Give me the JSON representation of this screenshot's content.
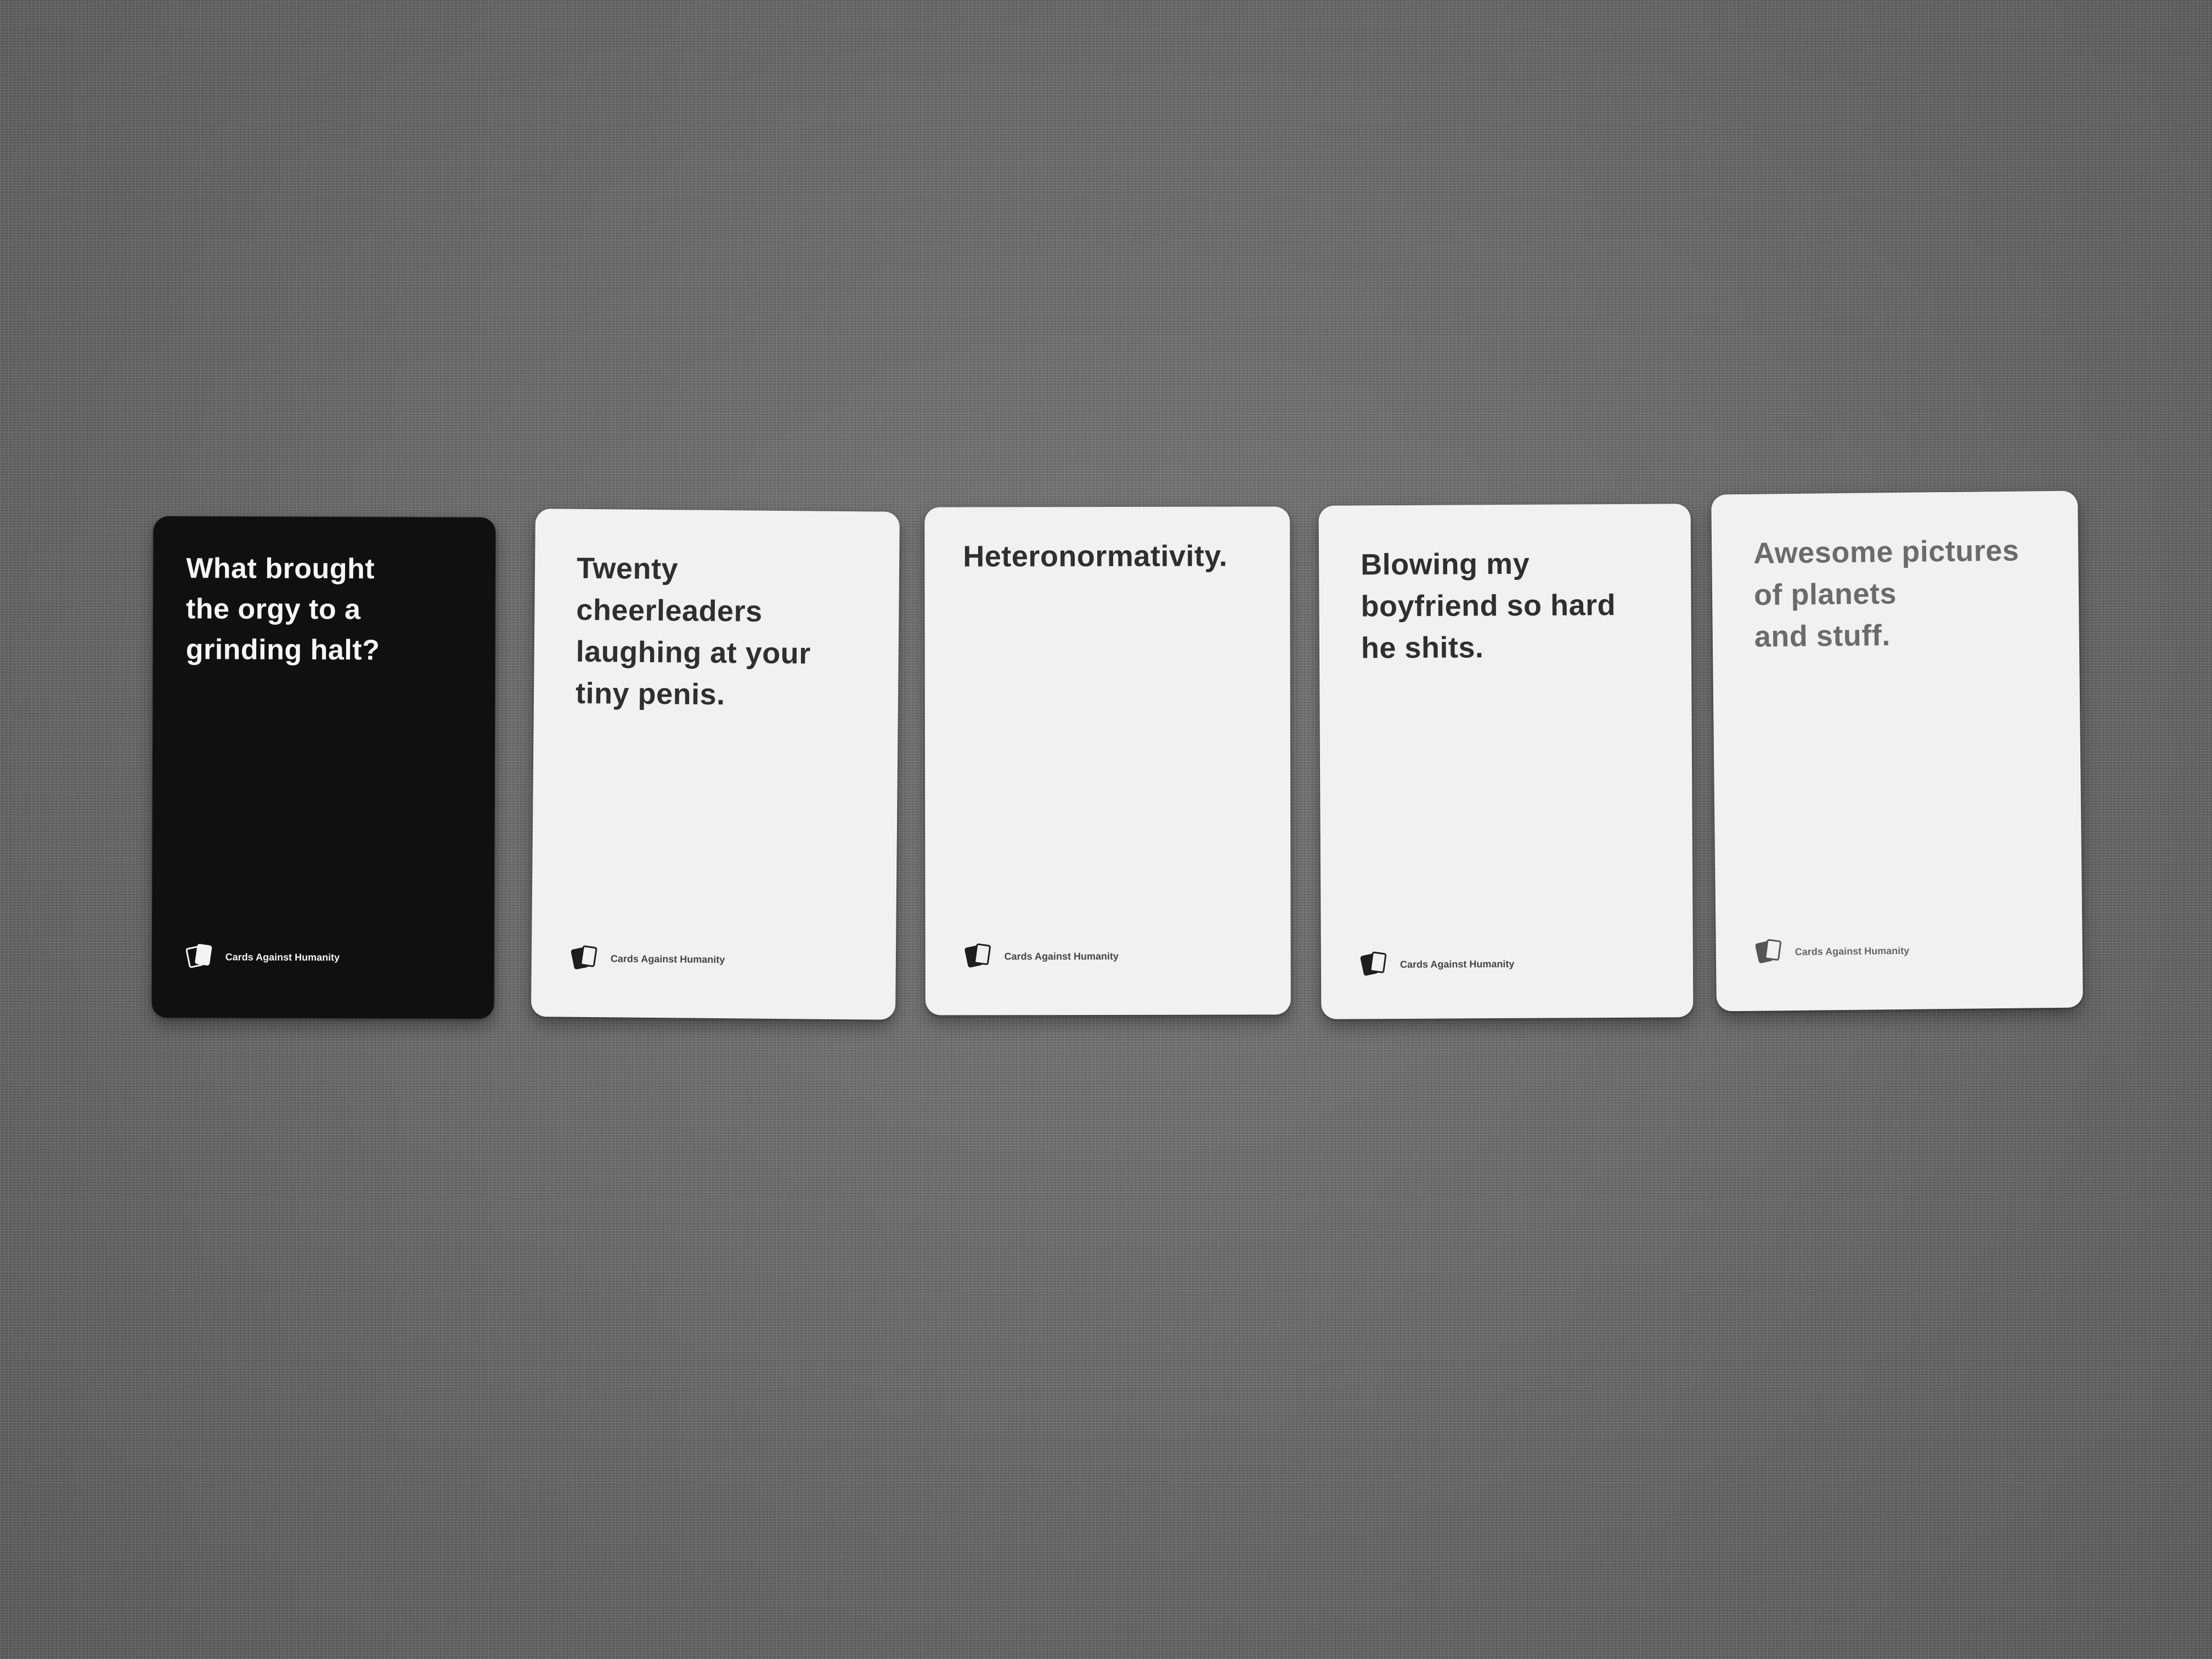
{
  "scene": {
    "background": "gray carpet",
    "background_color": "#6f6f6f"
  },
  "cards": [
    {
      "color": "black",
      "text": "What brought\nthe orgy to a\ngrinding halt?",
      "brand": "Cards Against Humanity",
      "icon": "cards-logo-icon"
    },
    {
      "color": "white",
      "text": "Twenty\ncheerleaders\nlaughing at your\ntiny penis.",
      "brand": "Cards Against Humanity",
      "icon": "cards-logo-icon"
    },
    {
      "color": "white",
      "text": "Heteronormativity.",
      "brand": "Cards Against Humanity",
      "icon": "cards-logo-icon"
    },
    {
      "color": "white",
      "text": "Blowing my\nboyfriend so hard\nhe shits.",
      "brand": "Cards Against Humanity",
      "icon": "cards-logo-icon"
    },
    {
      "color": "white",
      "text": "Awesome pictures\nof planets\nand stuff.",
      "brand": "Cards Against Humanity",
      "icon": "cards-logo-icon"
    }
  ]
}
